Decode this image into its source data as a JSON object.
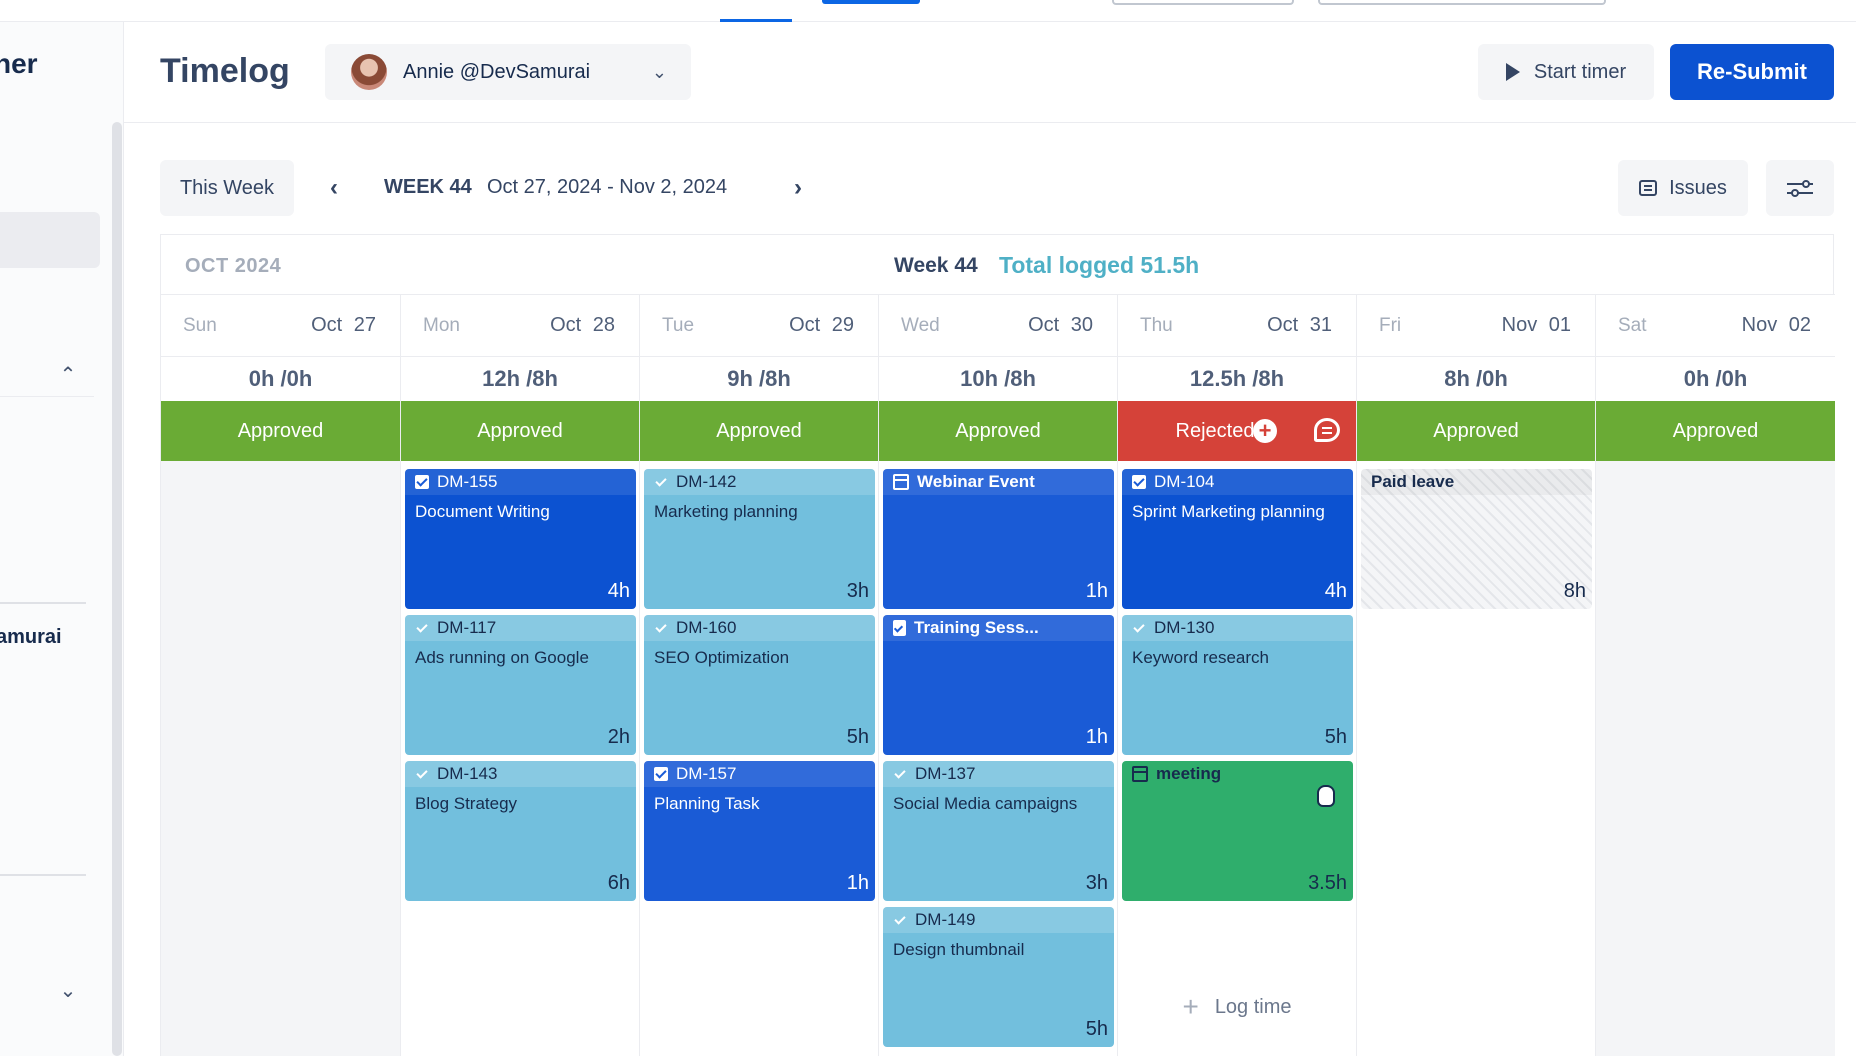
{
  "sidebar": {
    "title_fragment": "ner",
    "user_fragment": "amurai",
    "collapse_icon": "chevron-up-icon",
    "expand_icon": "chevron-down-icon"
  },
  "header": {
    "title": "Timelog",
    "user": "Annie @DevSamurai",
    "start_timer": "Start timer",
    "resubmit": "Re-Submit"
  },
  "nav": {
    "this_week": "This Week",
    "week": "WEEK 44",
    "range": "Oct 27, 2024 - Nov 2, 2024",
    "issues": "Issues"
  },
  "calendar": {
    "month": "OCT 2024",
    "week": "Week 44",
    "total": "Total logged 51.5h",
    "log_time": "Log time",
    "days": [
      {
        "name": "Sun",
        "date": "Oct 27",
        "hours": "0h /0h",
        "status": "Approved"
      },
      {
        "name": "Mon",
        "date": "Oct 28",
        "hours": "12h /8h",
        "status": "Approved"
      },
      {
        "name": "Tue",
        "date": "Oct 29",
        "hours": "9h /8h",
        "status": "Approved"
      },
      {
        "name": "Wed",
        "date": "Oct 30",
        "hours": "10h /8h",
        "status": "Approved"
      },
      {
        "name": "Thu",
        "date": "Oct 31",
        "hours": "12.5h /8h",
        "status": "Rejected"
      },
      {
        "name": "Fri",
        "date": "Nov 01",
        "hours": "8h /0h",
        "status": "Approved"
      },
      {
        "name": "Sat",
        "date": "Nov 02",
        "hours": "0h /0h",
        "status": "Approved"
      }
    ],
    "entries": {
      "mon": [
        {
          "key": "DM-155",
          "title": "Document Writing",
          "hours": "4h"
        },
        {
          "key": "DM-117",
          "title": "Ads running on Google",
          "hours": "2h"
        },
        {
          "key": "DM-143",
          "title": "Blog Strategy",
          "hours": "6h"
        }
      ],
      "tue": [
        {
          "key": "DM-142",
          "title": "Marketing planning",
          "hours": "3h"
        },
        {
          "key": "DM-160",
          "title": "SEO Optimization",
          "hours": "5h"
        },
        {
          "key": "DM-157",
          "title": "Planning Task",
          "hours": "1h"
        }
      ],
      "wed": [
        {
          "key": "Webinar Event",
          "title": "",
          "hours": "1h"
        },
        {
          "key": "Training Sess...",
          "title": "",
          "hours": "1h"
        },
        {
          "key": "DM-137",
          "title": "Social Media campaigns",
          "hours": "3h"
        },
        {
          "key": "DM-149",
          "title": "Design thumbnail",
          "hours": "5h"
        }
      ],
      "thu": [
        {
          "key": "DM-104",
          "title": "Sprint Marketing planning",
          "hours": "4h"
        },
        {
          "key": "DM-130",
          "title": "Keyword research",
          "hours": "5h"
        },
        {
          "key": "meeting",
          "title": "",
          "hours": "3.5h"
        }
      ],
      "fri": [
        {
          "key": "Paid leave",
          "title": "",
          "hours": "8h"
        }
      ]
    }
  },
  "colors": {
    "approved": "#6aab35",
    "rejected": "#d54239",
    "primary": "#0c52d1",
    "issue_dark": "#1a5bd6",
    "issue_light": "#72bfdd",
    "meeting": "#2fae6c",
    "total": "#4fb0c6"
  }
}
